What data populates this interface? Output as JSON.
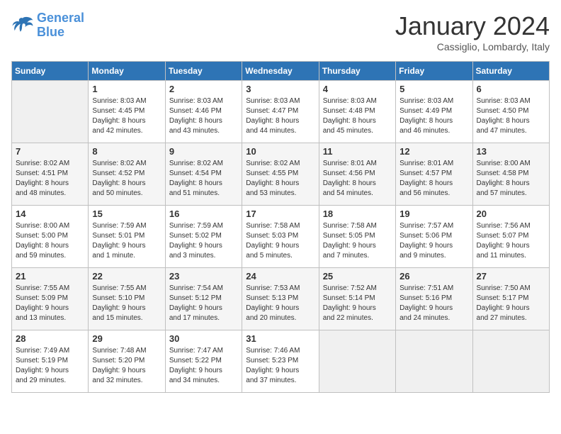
{
  "header": {
    "logo_line1": "General",
    "logo_line2": "Blue",
    "month": "January 2024",
    "location": "Cassiglio, Lombardy, Italy"
  },
  "days_of_week": [
    "Sunday",
    "Monday",
    "Tuesday",
    "Wednesday",
    "Thursday",
    "Friday",
    "Saturday"
  ],
  "weeks": [
    [
      {
        "num": "",
        "detail": ""
      },
      {
        "num": "1",
        "detail": "Sunrise: 8:03 AM\nSunset: 4:45 PM\nDaylight: 8 hours\nand 42 minutes."
      },
      {
        "num": "2",
        "detail": "Sunrise: 8:03 AM\nSunset: 4:46 PM\nDaylight: 8 hours\nand 43 minutes."
      },
      {
        "num": "3",
        "detail": "Sunrise: 8:03 AM\nSunset: 4:47 PM\nDaylight: 8 hours\nand 44 minutes."
      },
      {
        "num": "4",
        "detail": "Sunrise: 8:03 AM\nSunset: 4:48 PM\nDaylight: 8 hours\nand 45 minutes."
      },
      {
        "num": "5",
        "detail": "Sunrise: 8:03 AM\nSunset: 4:49 PM\nDaylight: 8 hours\nand 46 minutes."
      },
      {
        "num": "6",
        "detail": "Sunrise: 8:03 AM\nSunset: 4:50 PM\nDaylight: 8 hours\nand 47 minutes."
      }
    ],
    [
      {
        "num": "7",
        "detail": "Sunrise: 8:02 AM\nSunset: 4:51 PM\nDaylight: 8 hours\nand 48 minutes."
      },
      {
        "num": "8",
        "detail": "Sunrise: 8:02 AM\nSunset: 4:52 PM\nDaylight: 8 hours\nand 50 minutes."
      },
      {
        "num": "9",
        "detail": "Sunrise: 8:02 AM\nSunset: 4:54 PM\nDaylight: 8 hours\nand 51 minutes."
      },
      {
        "num": "10",
        "detail": "Sunrise: 8:02 AM\nSunset: 4:55 PM\nDaylight: 8 hours\nand 53 minutes."
      },
      {
        "num": "11",
        "detail": "Sunrise: 8:01 AM\nSunset: 4:56 PM\nDaylight: 8 hours\nand 54 minutes."
      },
      {
        "num": "12",
        "detail": "Sunrise: 8:01 AM\nSunset: 4:57 PM\nDaylight: 8 hours\nand 56 minutes."
      },
      {
        "num": "13",
        "detail": "Sunrise: 8:00 AM\nSunset: 4:58 PM\nDaylight: 8 hours\nand 57 minutes."
      }
    ],
    [
      {
        "num": "14",
        "detail": "Sunrise: 8:00 AM\nSunset: 5:00 PM\nDaylight: 8 hours\nand 59 minutes."
      },
      {
        "num": "15",
        "detail": "Sunrise: 7:59 AM\nSunset: 5:01 PM\nDaylight: 9 hours\nand 1 minute."
      },
      {
        "num": "16",
        "detail": "Sunrise: 7:59 AM\nSunset: 5:02 PM\nDaylight: 9 hours\nand 3 minutes."
      },
      {
        "num": "17",
        "detail": "Sunrise: 7:58 AM\nSunset: 5:03 PM\nDaylight: 9 hours\nand 5 minutes."
      },
      {
        "num": "18",
        "detail": "Sunrise: 7:58 AM\nSunset: 5:05 PM\nDaylight: 9 hours\nand 7 minutes."
      },
      {
        "num": "19",
        "detail": "Sunrise: 7:57 AM\nSunset: 5:06 PM\nDaylight: 9 hours\nand 9 minutes."
      },
      {
        "num": "20",
        "detail": "Sunrise: 7:56 AM\nSunset: 5:07 PM\nDaylight: 9 hours\nand 11 minutes."
      }
    ],
    [
      {
        "num": "21",
        "detail": "Sunrise: 7:55 AM\nSunset: 5:09 PM\nDaylight: 9 hours\nand 13 minutes."
      },
      {
        "num": "22",
        "detail": "Sunrise: 7:55 AM\nSunset: 5:10 PM\nDaylight: 9 hours\nand 15 minutes."
      },
      {
        "num": "23",
        "detail": "Sunrise: 7:54 AM\nSunset: 5:12 PM\nDaylight: 9 hours\nand 17 minutes."
      },
      {
        "num": "24",
        "detail": "Sunrise: 7:53 AM\nSunset: 5:13 PM\nDaylight: 9 hours\nand 20 minutes."
      },
      {
        "num": "25",
        "detail": "Sunrise: 7:52 AM\nSunset: 5:14 PM\nDaylight: 9 hours\nand 22 minutes."
      },
      {
        "num": "26",
        "detail": "Sunrise: 7:51 AM\nSunset: 5:16 PM\nDaylight: 9 hours\nand 24 minutes."
      },
      {
        "num": "27",
        "detail": "Sunrise: 7:50 AM\nSunset: 5:17 PM\nDaylight: 9 hours\nand 27 minutes."
      }
    ],
    [
      {
        "num": "28",
        "detail": "Sunrise: 7:49 AM\nSunset: 5:19 PM\nDaylight: 9 hours\nand 29 minutes."
      },
      {
        "num": "29",
        "detail": "Sunrise: 7:48 AM\nSunset: 5:20 PM\nDaylight: 9 hours\nand 32 minutes."
      },
      {
        "num": "30",
        "detail": "Sunrise: 7:47 AM\nSunset: 5:22 PM\nDaylight: 9 hours\nand 34 minutes."
      },
      {
        "num": "31",
        "detail": "Sunrise: 7:46 AM\nSunset: 5:23 PM\nDaylight: 9 hours\nand 37 minutes."
      },
      {
        "num": "",
        "detail": ""
      },
      {
        "num": "",
        "detail": ""
      },
      {
        "num": "",
        "detail": ""
      }
    ]
  ]
}
